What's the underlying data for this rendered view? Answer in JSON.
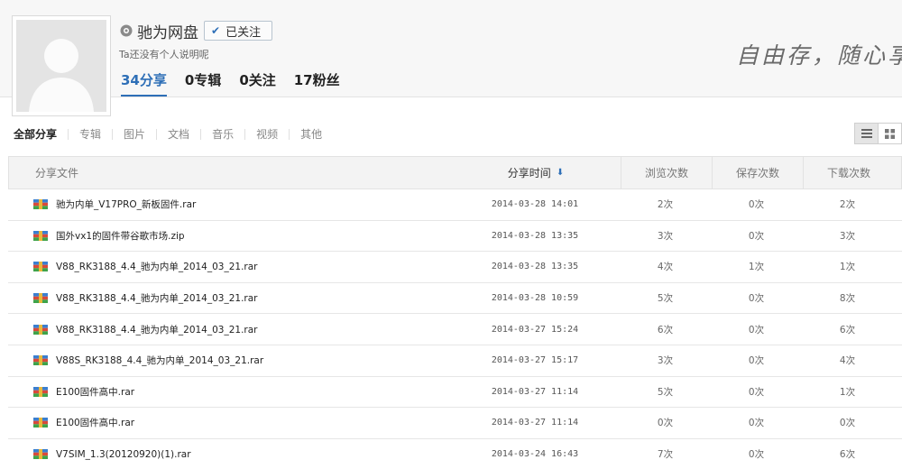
{
  "profile": {
    "name": "驰为网盘",
    "follow_label": "已关注",
    "bio": "Ta还没有个人说明呢",
    "stats": [
      {
        "label": "34分享",
        "active": true
      },
      {
        "label": "0专辑",
        "active": false
      },
      {
        "label": "0关注",
        "active": false
      },
      {
        "label": "17粉丝",
        "active": false
      }
    ],
    "slogan": "自由存，随心享"
  },
  "tabs": [
    "全部分享",
    "专辑",
    "图片",
    "文档",
    "音乐",
    "视频",
    "其他"
  ],
  "table": {
    "headers": {
      "name": "分享文件",
      "time": "分享时间",
      "views": "浏览次数",
      "saves": "保存次数",
      "downloads": "下载次数"
    },
    "rows": [
      {
        "name": "驰为内单_V17PRO_新板固件.rar",
        "time": "2014-03-28 14:01",
        "views": "2次",
        "saves": "0次",
        "downloads": "2次"
      },
      {
        "name": "国外vx1的固件带谷歌市场.zip",
        "time": "2014-03-28 13:35",
        "views": "3次",
        "saves": "0次",
        "downloads": "3次"
      },
      {
        "name": "V88_RK3188_4.4_驰为内单_2014_03_21.rar",
        "time": "2014-03-28 13:35",
        "views": "4次",
        "saves": "1次",
        "downloads": "1次"
      },
      {
        "name": "V88_RK3188_4.4_驰为内单_2014_03_21.rar",
        "time": "2014-03-28 10:59",
        "views": "5次",
        "saves": "0次",
        "downloads": "8次"
      },
      {
        "name": "V88_RK3188_4.4_驰为内单_2014_03_21.rar",
        "time": "2014-03-27 15:24",
        "views": "6次",
        "saves": "0次",
        "downloads": "6次"
      },
      {
        "name": "V88S_RK3188_4.4_驰为内单_2014_03_21.rar",
        "time": "2014-03-27 15:17",
        "views": "3次",
        "saves": "0次",
        "downloads": "4次"
      },
      {
        "name": "E100固件高中.rar",
        "time": "2014-03-27 11:14",
        "views": "5次",
        "saves": "0次",
        "downloads": "1次"
      },
      {
        "name": "E100固件高中.rar",
        "time": "2014-03-27 11:14",
        "views": "0次",
        "saves": "0次",
        "downloads": "0次"
      },
      {
        "name": "V7SIM_1.3(20120920)(1).rar",
        "time": "2014-03-24 16:43",
        "views": "7次",
        "saves": "0次",
        "downloads": "6次"
      }
    ]
  },
  "icons": {
    "gender": "gender-icon",
    "follow_check": "check-icon",
    "sort": "sort-down-icon",
    "file": "rar-file-icon",
    "list_view": "list-view-icon",
    "grid_view": "grid-view-icon"
  },
  "colors": {
    "accent": "#2e6fb7",
    "header_bg": "#f7f7f7"
  }
}
